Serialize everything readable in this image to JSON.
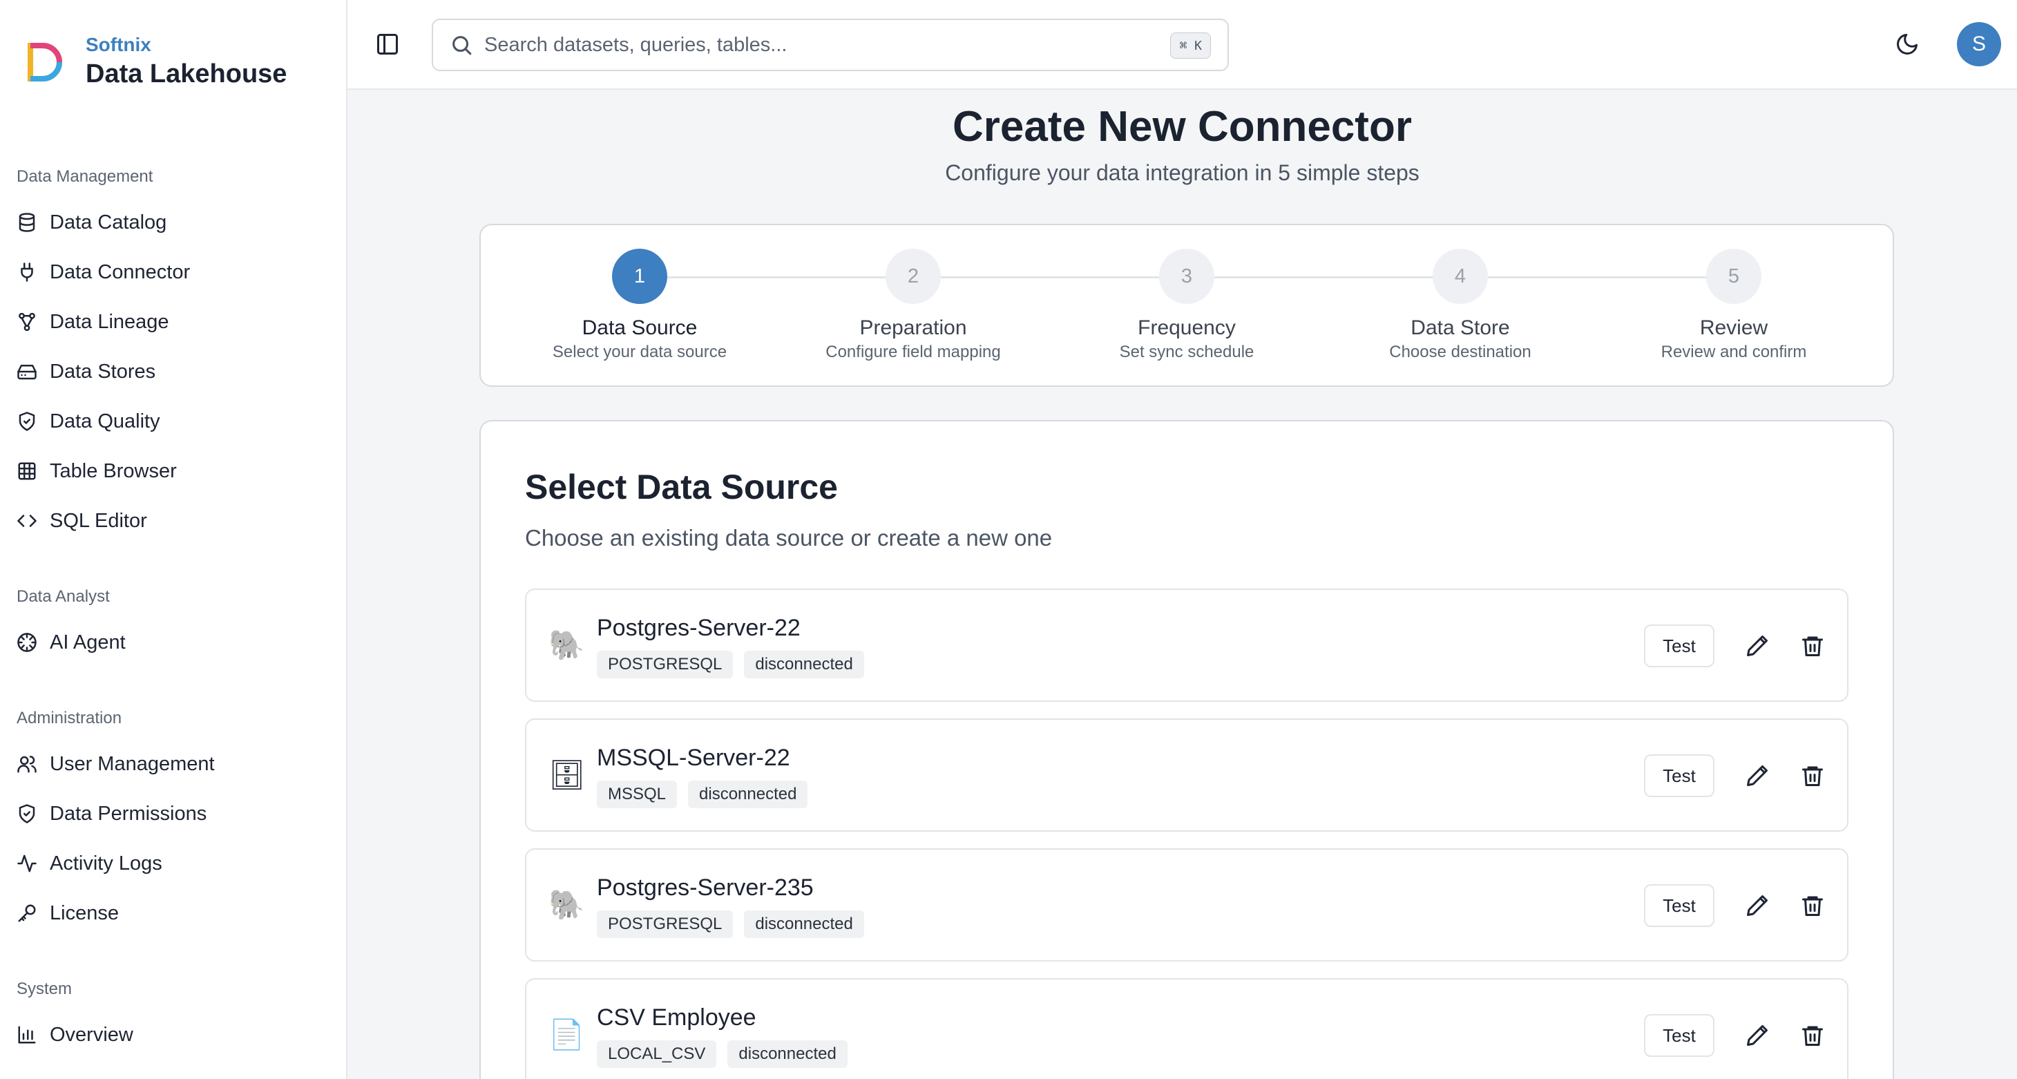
{
  "brand": {
    "company": "Softnix",
    "product": "Data Lakehouse"
  },
  "sidebar": {
    "sections": [
      {
        "label": "Data Management"
      },
      {
        "label": "Data Analyst"
      },
      {
        "label": "Administration"
      },
      {
        "label": "System"
      }
    ],
    "items": [
      {
        "label": "Data Catalog",
        "icon": "database-icon"
      },
      {
        "label": "Data Connector",
        "icon": "plug-icon"
      },
      {
        "label": "Data Lineage",
        "icon": "lineage-icon"
      },
      {
        "label": "Data Stores",
        "icon": "hard-drive-icon"
      },
      {
        "label": "Data Quality",
        "icon": "shield-check-icon"
      },
      {
        "label": "Table Browser",
        "icon": "table-icon"
      },
      {
        "label": "SQL Editor",
        "icon": "code-icon"
      },
      {
        "label": "AI Agent",
        "icon": "bot-icon"
      },
      {
        "label": "User Management",
        "icon": "users-icon"
      },
      {
        "label": "Data Permissions",
        "icon": "shield-check-icon"
      },
      {
        "label": "Activity Logs",
        "icon": "activity-icon"
      },
      {
        "label": "License",
        "icon": "key-icon"
      },
      {
        "label": "Overview",
        "icon": "bar-chart-icon"
      }
    ]
  },
  "topbar": {
    "search_placeholder": "Search datasets, queries, tables...",
    "shortcut": "⌘ K",
    "avatar_initial": "S"
  },
  "page": {
    "title": "Create New Connector",
    "subtitle": "Configure your data integration in 5 simple steps"
  },
  "steps": [
    {
      "number": "1",
      "name": "Data Source",
      "desc": "Select your data source",
      "active": true
    },
    {
      "number": "2",
      "name": "Preparation",
      "desc": "Configure field mapping",
      "active": false
    },
    {
      "number": "3",
      "name": "Frequency",
      "desc": "Set sync schedule",
      "active": false
    },
    {
      "number": "4",
      "name": "Data Store",
      "desc": "Choose destination",
      "active": false
    },
    {
      "number": "5",
      "name": "Review",
      "desc": "Review and confirm",
      "active": false
    }
  ],
  "card": {
    "title": "Select Data Source",
    "desc": "Choose an existing data source or create a new one"
  },
  "sources": [
    {
      "name": "Postgres-Server-22",
      "type": "POSTGRESQL",
      "status": "disconnected",
      "icon": "🐘",
      "test_label": "Test"
    },
    {
      "name": "MSSQL-Server-22",
      "type": "MSSQL",
      "status": "disconnected",
      "icon": "🗄",
      "test_label": "Test"
    },
    {
      "name": "Postgres-Server-235",
      "type": "POSTGRESQL",
      "status": "disconnected",
      "icon": "🐘",
      "test_label": "Test"
    },
    {
      "name": "CSV Employee",
      "type": "LOCAL_CSV",
      "status": "disconnected",
      "icon": "📄",
      "test_label": "Test"
    }
  ],
  "colors": {
    "accent": "#3d7fc1",
    "border": "#d6d9de",
    "background": "#f4f5f7"
  }
}
